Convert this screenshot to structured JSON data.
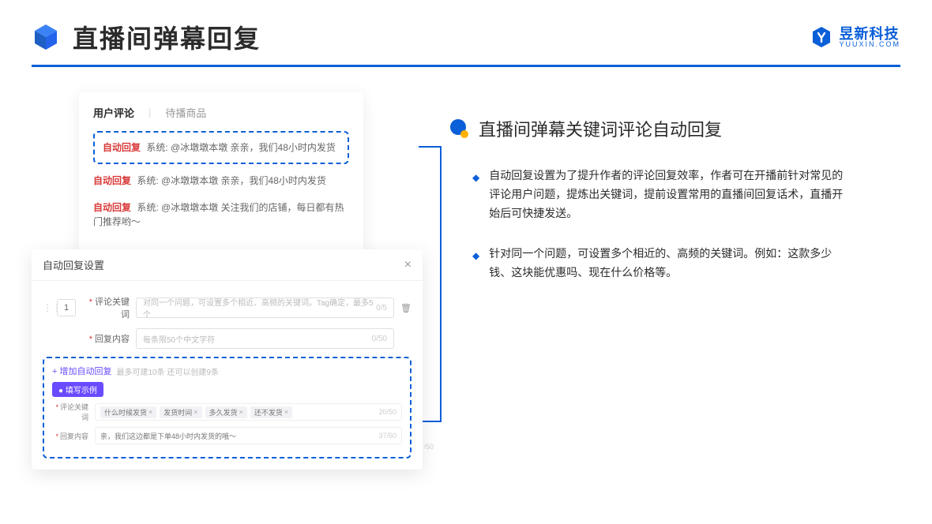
{
  "header": {
    "title": "直播间弹幕回复",
    "brand_cn": "昱新科技",
    "brand_en": "YUUXIN.COM"
  },
  "comment_card": {
    "tab_active": "用户评论",
    "tab_inactive": "待播商品",
    "highlight_tag": "自动回复",
    "highlight_text": "系统: @冰墩墩本墩 亲亲，我们48小时内发货",
    "row2_tag": "自动回复",
    "row2_text": "系统: @冰墩墩本墩 亲亲，我们48小时内发货",
    "row3_tag": "自动回复",
    "row3_text": "系统: @冰墩墩本墩 关注我们的店铺，每日都有热门推荐哟～"
  },
  "settings": {
    "title": "自动回复设置",
    "order": "1",
    "row1_label": "评论关键词",
    "row1_placeholder": "对同一个问题，可设置多个相近、高频的关键词。Tag确定，最多5个",
    "row1_counter": "0/5",
    "row2_label": "回复内容",
    "row2_placeholder": "每条限50个中文字符",
    "row2_counter": "0/50",
    "add_label": "+ 增加自动回复",
    "add_hint": "最多可建10条 还可以创建9条",
    "example_tag": "● 填写示例",
    "ex_row1_label": "评论关键词",
    "ex_chips": [
      "什么时候发货",
      "发货时间",
      "多久发货",
      "还不发货"
    ],
    "ex_row1_counter": "20/50",
    "ex_row2_label": "回复内容",
    "ex_row2_text": "亲，我们这边都是下单48小时内发货的哦～",
    "ex_row2_counter": "37/50",
    "ghost_counter": "/50"
  },
  "right": {
    "section_title": "直播间弹幕关键词评论自动回复",
    "bullet1": "自动回复设置为了提升作者的评论回复效率，作者可在开播前针对常见的评论用户问题，提炼出关键词，提前设置常用的直播间回复话术，直播开始后可快捷发送。",
    "bullet2": "针对同一个问题，可设置多个相近的、高频的关键词。例如：这款多少钱、这块能优惠吗、现在什么价格等。"
  }
}
